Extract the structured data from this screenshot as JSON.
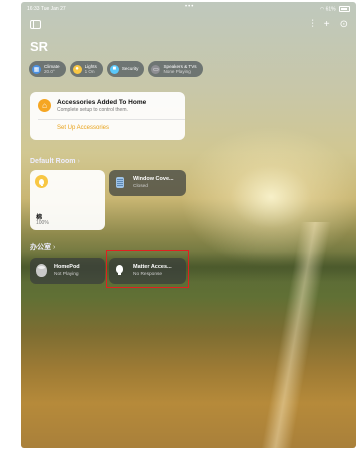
{
  "status": {
    "time": "16:33",
    "date": "Tue Jan 27",
    "dots": "•••",
    "battery": "61%"
  },
  "header": {
    "title": "SR",
    "sound_icon": "waveform-icon",
    "add_icon": "plus-icon",
    "more_icon": "ellipsis-circle-icon"
  },
  "pills": [
    {
      "label": "Climate",
      "sub": "20.0°",
      "icon": "climate-icon",
      "color": "#4a90e2"
    },
    {
      "label": "Lights",
      "sub": "1 On",
      "icon": "lightbulb-icon",
      "color": "#f8c744"
    },
    {
      "label": "Security",
      "sub": "",
      "icon": "lock-icon",
      "color": "#5ac8fa"
    },
    {
      "label": "Speakers & TVs",
      "sub": "None Playing",
      "icon": "tv-icon",
      "color": "#8e8e93"
    }
  ],
  "notice": {
    "title": "Accessories Added To Home",
    "subtitle": "Complete setup to control them.",
    "action": "Set Up Accessories"
  },
  "rooms": [
    {
      "name": "Default Room",
      "chevron": "›",
      "tiles": [
        {
          "name": "棉",
          "status": "100%",
          "state": "on",
          "icon": "lightbulb-icon"
        },
        {
          "name": "Window Cove...",
          "status": "Closed",
          "state": "off",
          "icon": "window-blinds-icon"
        }
      ]
    },
    {
      "name": "办公室",
      "chevron": "›",
      "tiles": [
        {
          "name": "HomePod",
          "status": "Not Playing",
          "state": "off",
          "icon": "homepod-icon"
        },
        {
          "name": "Matter Acces...",
          "status": "No Response",
          "state": "off",
          "icon": "lightbulb-icon"
        }
      ]
    }
  ],
  "colors": {
    "accent": "#e8a21a",
    "highlight": "#e02020"
  }
}
